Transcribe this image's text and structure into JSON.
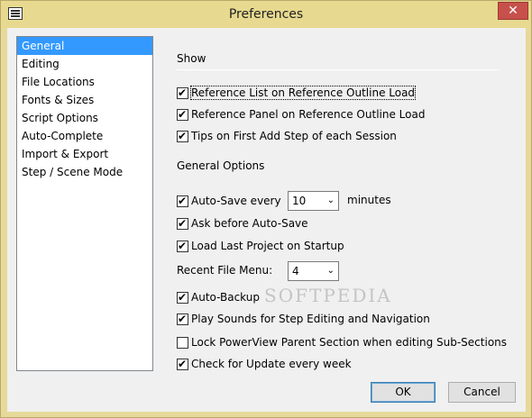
{
  "window": {
    "title": "Preferences",
    "close_label": "✕"
  },
  "sidebar": {
    "items": [
      {
        "label": "General",
        "selected": true
      },
      {
        "label": "Editing"
      },
      {
        "label": "File Locations"
      },
      {
        "label": "Fonts & Sizes"
      },
      {
        "label": "Script Options"
      },
      {
        "label": "Auto-Complete"
      },
      {
        "label": "Import & Export"
      },
      {
        "label": "Step / Scene Mode"
      }
    ]
  },
  "show": {
    "heading": "Show",
    "reference_list": "Reference List on Reference Outline Load",
    "reference_panel": "Reference Panel on Reference Outline Load",
    "tips": "Tips on First Add Step of each Session"
  },
  "general": {
    "heading": "General Options",
    "autosave_label": "Auto-Save every",
    "autosave_value": "10",
    "minutes_label": "minutes",
    "ask_before": "Ask before Auto-Save",
    "load_last": "Load Last Project on Startup",
    "recent_label": "Recent File Menu:",
    "recent_value": "4",
    "auto_backup": "Auto-Backup",
    "play_sounds": "Play Sounds for Step Editing and Navigation",
    "lock_powerview": "Lock PowerView Parent Section when editing Sub-Sections",
    "check_update": "Check for Update every week"
  },
  "buttons": {
    "ok": "OK",
    "cancel": "Cancel"
  },
  "watermark": "SOFTPEDIA"
}
